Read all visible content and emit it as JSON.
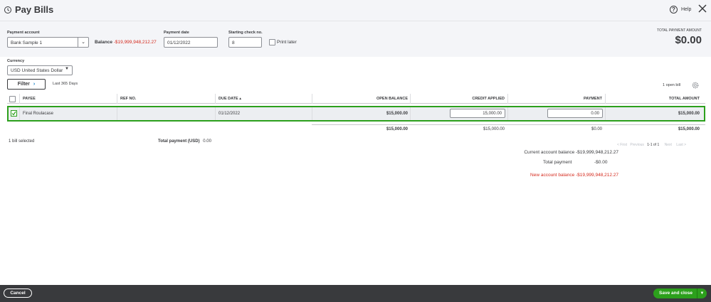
{
  "header": {
    "title": "Pay Bills",
    "help": "Help",
    "icon": "history-clock-icon",
    "close_icon": "close-icon"
  },
  "form": {
    "payment_account_label": "Payment account",
    "payment_account_value": "Bank Sample 1",
    "balance_label": "Balance",
    "balance_value": "-$19,999,948,212.27",
    "payment_date_label": "Payment date",
    "payment_date_value": "01/12/2022",
    "check_no_label": "Starting check no.",
    "check_no_value": "8",
    "print_later_label": "Print later",
    "total_payment_amount_label": "TOTAL PAYMENT AMOUNT",
    "total_payment_amount_value": "$0.00",
    "currency_label": "Currency",
    "currency_value": "USD United States Dollar"
  },
  "filter": {
    "button_label": "Filter",
    "range_text": "Last 365 Days",
    "open_bill_count": "1 open bill"
  },
  "table": {
    "columns": [
      "PAYEE",
      "REF NO.",
      "DUE DATE ▴",
      "OPEN BALANCE",
      "CREDIT APPLIED",
      "PAYMENT",
      "TOTAL AMOUNT"
    ],
    "rows": [
      {
        "checked": true,
        "payee": "Final Roulacase",
        "ref_no": "",
        "due_date": "01/12/2022",
        "open_balance": "$15,000.00",
        "credit_applied": "15,000.00",
        "payment": "0.00",
        "total_amount": "$15,000.00"
      }
    ],
    "totals": {
      "open_balance": "$15,000.00",
      "credit_applied": "$15,000.00",
      "payment": "$0.00",
      "total_amount": "$15,000.00"
    }
  },
  "footer": {
    "bills_selected": "1 bill selected",
    "total_payment_label": "Total payment",
    "total_payment_currency": "(USD)",
    "total_payment_value": "0.00",
    "pager": {
      "first": "< First",
      "previous": "Previous",
      "range": "1-1 of 1",
      "next": "Next",
      "last": "Last >"
    }
  },
  "summary": {
    "current_label": "Current account balance",
    "current_value": "-$19,999,948,212.27",
    "total_payment_label": "Total payment",
    "total_payment_value": "-$0.00",
    "new_label": "New account balance",
    "new_value": "-$19,999,948,212.27"
  },
  "bottom": {
    "cancel_label": "Cancel",
    "save_label": "Save and close"
  },
  "colors": {
    "accent_green": "#2ca01c",
    "negative_red": "#d52b1e",
    "bottom_bar": "#393a3d"
  }
}
